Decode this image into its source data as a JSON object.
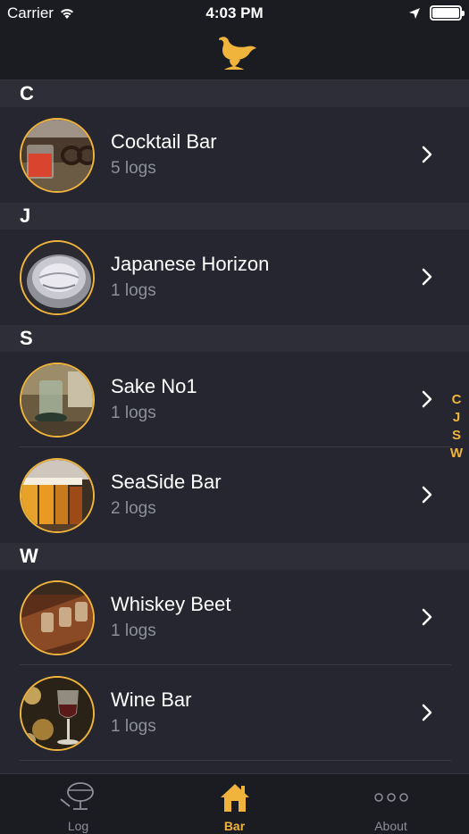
{
  "status": {
    "carrier": "Carrier",
    "time": "4:03 PM"
  },
  "colors": {
    "accent": "#f0b43c",
    "background": "#25262f",
    "section": "#2d2e38",
    "bar": "#1b1c22"
  },
  "nav": {
    "logo_icon": "bird-icon"
  },
  "sections": [
    {
      "letter": "C",
      "rows": [
        {
          "title": "Cocktail Bar",
          "sub": "5 logs"
        }
      ]
    },
    {
      "letter": "J",
      "rows": [
        {
          "title": "Japanese Horizon",
          "sub": "1 logs"
        }
      ]
    },
    {
      "letter": "S",
      "rows": [
        {
          "title": "Sake No1",
          "sub": "1 logs"
        },
        {
          "title": "SeaSide Bar",
          "sub": "2 logs"
        }
      ]
    },
    {
      "letter": "W",
      "rows": [
        {
          "title": "Whiskey Beet",
          "sub": "1 logs"
        },
        {
          "title": "Wine Bar",
          "sub": "1 logs"
        }
      ]
    }
  ],
  "index": [
    "C",
    "J",
    "S",
    "W"
  ],
  "tabs": [
    {
      "label": "Log",
      "icon": "glass-icon"
    },
    {
      "label": "Bar",
      "icon": "house-icon"
    },
    {
      "label": "About",
      "icon": "more-dots-icon"
    }
  ]
}
